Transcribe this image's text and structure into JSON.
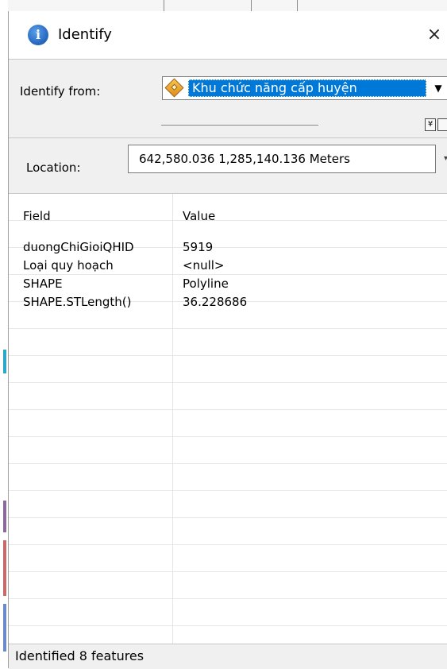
{
  "window": {
    "title": "Identify",
    "close_symbol": "×"
  },
  "identify_from": {
    "label": "Identify from:",
    "selected_layer": "Khu chức năng cấp huyện",
    "arrow": "▼"
  },
  "toolbar": {
    "collapse_symbol": "¥"
  },
  "location": {
    "label": "Location:",
    "value": "642,580.036  1,285,140.136 Meters"
  },
  "grid": {
    "headers": {
      "field": "Field",
      "value": "Value"
    },
    "rows": [
      {
        "field": "duongChiGioiQHID",
        "value": "5919"
      },
      {
        "field": "Loại quy hoạch",
        "value": "<null>"
      },
      {
        "field": "SHAPE",
        "value": "Polyline"
      },
      {
        "field": "SHAPE.STLength()",
        "value": "36.228686"
      }
    ]
  },
  "status": {
    "text": "Identified 8 features"
  },
  "colors": {
    "selection": "#0078d7",
    "window_bg": "#f0f0f0",
    "title_icon": "#2a6cc4"
  },
  "icons": {
    "title": "info-icon",
    "layer": "layer-diamond-icon",
    "close": "close-icon"
  }
}
